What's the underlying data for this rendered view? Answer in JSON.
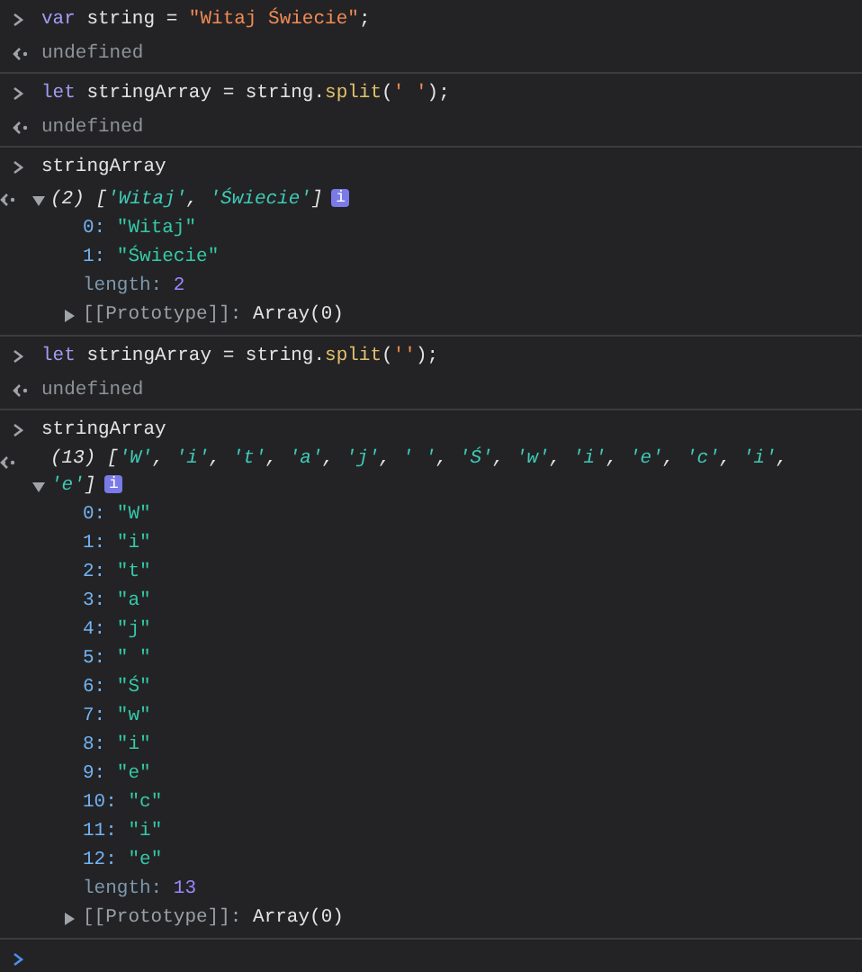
{
  "groups": [
    {
      "input": [
        {
          "kind": "keyword",
          "text": "var"
        },
        {
          "kind": "plain",
          "text": " string = "
        },
        {
          "kind": "string",
          "text": "\"Witaj Świecie\""
        },
        {
          "kind": "plain",
          "text": ";"
        }
      ],
      "output": {
        "kind": "undefined",
        "text": "undefined"
      }
    },
    {
      "input": [
        {
          "kind": "keyword",
          "text": "let"
        },
        {
          "kind": "plain",
          "text": " stringArray = string."
        },
        {
          "kind": "method",
          "text": "split"
        },
        {
          "kind": "plain",
          "text": "("
        },
        {
          "kind": "string",
          "text": "' '"
        },
        {
          "kind": "plain",
          "text": ");"
        }
      ],
      "output": {
        "kind": "undefined",
        "text": "undefined"
      }
    },
    {
      "input": [
        {
          "kind": "plain",
          "text": "stringArray"
        }
      ],
      "output": {
        "kind": "array",
        "expanded": true,
        "badge": "i",
        "summary": [
          {
            "kind": "count",
            "text": "(2) "
          },
          {
            "kind": "punct",
            "text": "["
          },
          {
            "kind": "item",
            "text": "'Witaj'"
          },
          {
            "kind": "punct",
            "text": ", "
          },
          {
            "kind": "item",
            "text": "'Świecie'"
          },
          {
            "kind": "punct",
            "text": "]"
          }
        ],
        "properties": [
          {
            "kind": "index",
            "key": "0:",
            "value": "\"Witaj\""
          },
          {
            "kind": "index",
            "key": "1:",
            "value": "\"Świecie\""
          },
          {
            "kind": "length",
            "key": "length:",
            "value": "2"
          }
        ],
        "prototype": {
          "key": "[[Prototype]]:",
          "value": "Array(0)",
          "expanded": false
        }
      }
    },
    {
      "input": [
        {
          "kind": "keyword",
          "text": "let"
        },
        {
          "kind": "plain",
          "text": " stringArray = string."
        },
        {
          "kind": "method",
          "text": "split"
        },
        {
          "kind": "plain",
          "text": "("
        },
        {
          "kind": "string",
          "text": "''"
        },
        {
          "kind": "plain",
          "text": ");"
        }
      ],
      "output": {
        "kind": "undefined",
        "text": "undefined"
      }
    },
    {
      "input": [
        {
          "kind": "plain",
          "text": "stringArray"
        }
      ],
      "output": {
        "kind": "array",
        "expanded": true,
        "badge": "i",
        "summary": [
          {
            "kind": "count",
            "text": "(13) "
          },
          {
            "kind": "punct",
            "text": "["
          },
          {
            "kind": "item",
            "text": "'W'"
          },
          {
            "kind": "punct",
            "text": ", "
          },
          {
            "kind": "item",
            "text": "'i'"
          },
          {
            "kind": "punct",
            "text": ", "
          },
          {
            "kind": "item",
            "text": "'t'"
          },
          {
            "kind": "punct",
            "text": ", "
          },
          {
            "kind": "item",
            "text": "'a'"
          },
          {
            "kind": "punct",
            "text": ", "
          },
          {
            "kind": "item",
            "text": "'j'"
          },
          {
            "kind": "punct",
            "text": ", "
          },
          {
            "kind": "item",
            "text": "' '"
          },
          {
            "kind": "punct",
            "text": ", "
          },
          {
            "kind": "item",
            "text": "'Ś'"
          },
          {
            "kind": "punct",
            "text": ", "
          },
          {
            "kind": "item",
            "text": "'w'"
          },
          {
            "kind": "punct",
            "text": ", "
          },
          {
            "kind": "item",
            "text": "'i'"
          },
          {
            "kind": "punct",
            "text": ", "
          },
          {
            "kind": "item",
            "text": "'e'"
          },
          {
            "kind": "punct",
            "text": ", "
          },
          {
            "kind": "item",
            "text": "'c'"
          },
          {
            "kind": "punct",
            "text": ", "
          },
          {
            "kind": "item",
            "text": "'i'"
          },
          {
            "kind": "punct",
            "text": ", "
          },
          {
            "kind": "item",
            "text": "'e'"
          },
          {
            "kind": "punct",
            "text": "]"
          }
        ],
        "properties": [
          {
            "kind": "index",
            "key": "0:",
            "value": "\"W\""
          },
          {
            "kind": "index",
            "key": "1:",
            "value": "\"i\""
          },
          {
            "kind": "index",
            "key": "2:",
            "value": "\"t\""
          },
          {
            "kind": "index",
            "key": "3:",
            "value": "\"a\""
          },
          {
            "kind": "index",
            "key": "4:",
            "value": "\"j\""
          },
          {
            "kind": "index",
            "key": "5:",
            "value": "\" \""
          },
          {
            "kind": "index",
            "key": "6:",
            "value": "\"Ś\""
          },
          {
            "kind": "index",
            "key": "7:",
            "value": "\"w\""
          },
          {
            "kind": "index",
            "key": "8:",
            "value": "\"i\""
          },
          {
            "kind": "index",
            "key": "9:",
            "value": "\"e\""
          },
          {
            "kind": "index",
            "key": "10:",
            "value": "\"c\""
          },
          {
            "kind": "index",
            "key": "11:",
            "value": "\"i\""
          },
          {
            "kind": "index",
            "key": "12:",
            "value": "\"e\""
          },
          {
            "kind": "length",
            "key": "length:",
            "value": "13"
          }
        ],
        "prototype": {
          "key": "[[Prototype]]:",
          "value": "Array(0)",
          "expanded": false
        }
      }
    }
  ]
}
